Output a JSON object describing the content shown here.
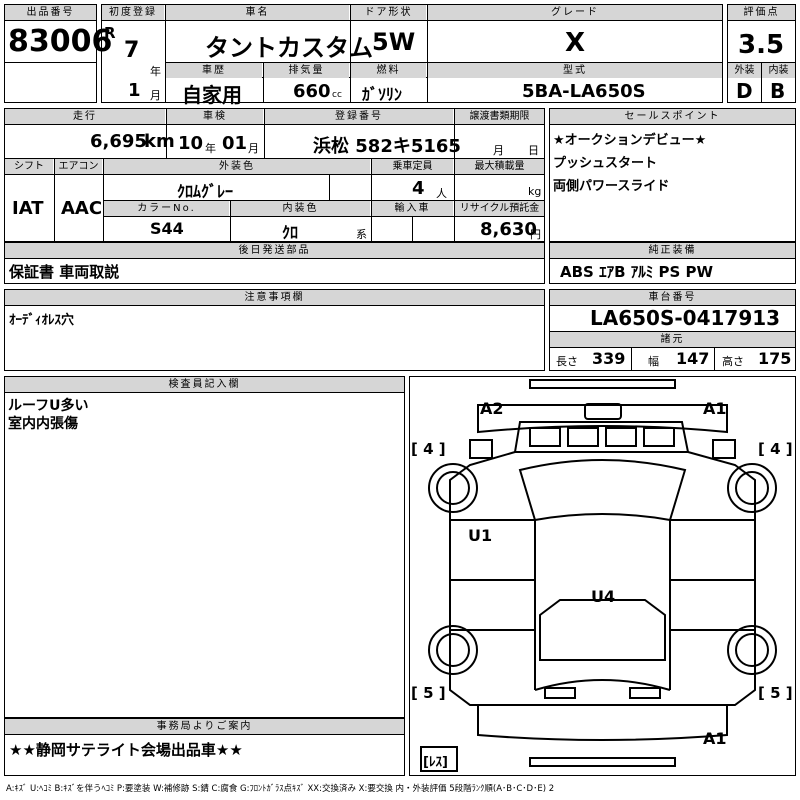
{
  "h_lot": "出品番号",
  "lot": "83006",
  "h_first_reg": "初度登録",
  "era": "R",
  "reg_year": "7",
  "u_year": "年",
  "reg_month": "1",
  "u_month": "月",
  "h_name": "車名",
  "car_name": "タントカスタム",
  "h_door": "ドア形状",
  "door": "5W",
  "h_grade": "グレード",
  "grade": "X",
  "h_score": "評価点",
  "score": "3.5",
  "h_history": "車歴",
  "history": "自家用",
  "h_disp": "排気量",
  "disp": "660",
  "disp_unit": "cc",
  "h_fuel": "燃料",
  "fuel": "ｶﾞｿﾘﾝ",
  "h_model": "型式",
  "model": "5BA-LA650S",
  "h_ext": "外装",
  "ext": "D",
  "h_int": "内装",
  "int": "B",
  "h_mileage": "走行",
  "mileage": "6,695",
  "u_km": "km",
  "h_inspect": "車検",
  "insp_y": "10",
  "insp_m": "01",
  "u_year2": "年",
  "u_month2": "月",
  "h_plate": "登録番号",
  "plate": "浜松 582キ5165",
  "h_transfer": "譲渡書類期限",
  "u_month3": "月",
  "u_day": "日",
  "h_sales": "セールスポイント",
  "sales": [
    "★オークションデビュー★",
    "プッシュスタート",
    "両側パワースライド"
  ],
  "h_shift": "シフト",
  "shift": "IAT",
  "h_ac": "エアコン",
  "ac": "AAC",
  "h_color": "外装色",
  "color": "ｸﾛﾑｸﾞﾚｰ",
  "h_seats": "乗車定員",
  "seats": "4",
  "u_seats": "人",
  "h_load": "最大積載量",
  "u_kg": "kg",
  "h_colorno": "カラーNo.",
  "colorno": "S44",
  "h_intcolor": "内装色",
  "intcolor": "ｸﾛ",
  "u_kei": "系",
  "h_import": "輸入車",
  "h_recycle": "リサイクル預託金",
  "recycle": "8,630",
  "u_yen": "円",
  "h_later": "後日発送部品",
  "later": "保証書 車両取説",
  "h_equip": "純正装備",
  "equip": "ABS ｴｱB ｱﾙﾐ PS PW",
  "h_notes": "注意事項欄",
  "notes": "ｵｰﾃﾞｨｵﾚｽ穴",
  "h_chassis": "車台番号",
  "chassis": "LA650S-0417913",
  "h_dims": "諸元",
  "l_len": "長さ",
  "len": "339",
  "l_wid": "幅",
  "wid": "147",
  "l_hgt": "高さ",
  "hgt": "175",
  "h_inspector": "検査員記入欄",
  "inspector": [
    "ルーフU多い",
    "室内内張傷"
  ],
  "h_office": "事務局よりご案内",
  "office": "★★静岡サテライト会場出品車★★",
  "legend": "A:ｷｽﾞ U:ﾍｺﾐ B:ｷｽﾞを伴うﾍｺﾐ P:要塗装 W:補修跡 S:錆 C:腐食 G:ﾌﾛﾝﾄｶﾞﾗｽ点ｷｽﾞ XX:交換済み X:要交換 内・外装評価 5段階ﾗﾝｸ順(A･B･C･D･E) 2",
  "diagram": {
    "a2": "A2",
    "a1_top": "A1",
    "a1_bottom": "A1",
    "u1": "U1",
    "u4": "U4",
    "tire_fl": "[ 4 ]",
    "tire_fr": "[ 4 ]",
    "tire_rl": "[ 5 ]",
    "tire_rr": "[ 5 ]",
    "spare": "[ﾚｽ]"
  }
}
